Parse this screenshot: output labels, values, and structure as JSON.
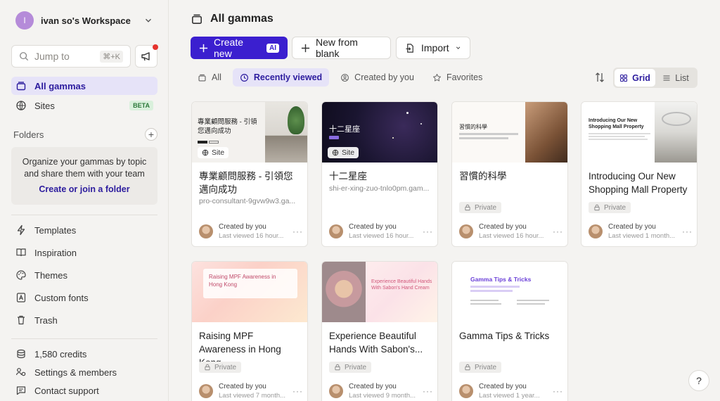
{
  "sidebar": {
    "workspace": {
      "initial": "I",
      "name": "ivan so's Workspace"
    },
    "search": {
      "placeholder": "Jump to",
      "shortcut": "⌘+K"
    },
    "nav": [
      {
        "label": "All gammas"
      },
      {
        "label": "Sites",
        "badge": "BETA"
      }
    ],
    "folders": {
      "title": "Folders",
      "empty_text": "Organize your gammas by topic and share them with your team",
      "cta": "Create or join a folder"
    },
    "links": [
      {
        "label": "Templates"
      },
      {
        "label": "Inspiration"
      },
      {
        "label": "Themes"
      },
      {
        "label": "Custom fonts"
      },
      {
        "label": "Trash"
      }
    ],
    "bottom": [
      {
        "label": "1,580 credits"
      },
      {
        "label": "Settings & members"
      },
      {
        "label": "Contact support"
      }
    ]
  },
  "main": {
    "title": "All gammas",
    "actions": {
      "create_new": "Create new",
      "ai_badge": "AI",
      "new_from_blank": "New from blank",
      "import": "Import"
    },
    "filters": [
      {
        "label": "All"
      },
      {
        "label": "Recently viewed"
      },
      {
        "label": "Created by you"
      },
      {
        "label": "Favorites"
      }
    ],
    "view": {
      "grid": "Grid",
      "list": "List"
    },
    "cards": [
      {
        "title": "專業顧問服務 - 引領您邁向成功",
        "subtitle": "pro-consultant-9gvw9w3.ga...",
        "site_badge": "Site",
        "creator": "Created by you",
        "viewed": "Last viewed 16 hour...",
        "thumb_text": "專業顧問服務 - 引領您邁向成功"
      },
      {
        "title": "十二星座",
        "subtitle": "shi-er-xing-zuo-tnlo0pm.gam...",
        "site_badge": "Site",
        "creator": "Created by you",
        "viewed": "Last viewed 16 hour...",
        "thumb_text": "十二星座"
      },
      {
        "title": "習慣的科學",
        "privacy": "Private",
        "creator": "Created by you",
        "viewed": "Last viewed 16 hour...",
        "thumb_text": "習慣的科學"
      },
      {
        "title": "Introducing Our New Shopping Mall Property",
        "privacy": "Private",
        "creator": "Created by you",
        "viewed": "Last viewed 1 month...",
        "thumb_text": "Introducing Our New Shopping Mall Property"
      },
      {
        "title": "Raising MPF Awareness in Hong Kong",
        "privacy": "Private",
        "creator": "Created by you",
        "viewed": "Last viewed 7 month...",
        "thumb_text": "Raising MPF Awareness in Hong Kong"
      },
      {
        "title": "Experience Beautiful Hands With Sabon's...",
        "privacy": "Private",
        "creator": "Created by you",
        "viewed": "Last viewed 9 month...",
        "thumb_text": "Experience Beautiful Hands With Sabon's Hand Cream"
      },
      {
        "title": "Gamma Tips & Tricks",
        "privacy": "Private",
        "creator": "Created by you",
        "viewed": "Last viewed 1 year...",
        "thumb_text": "Gamma Tips & Tricks"
      }
    ],
    "help": "?"
  },
  "colors": {
    "accent": "#3b1fcf",
    "active_bg": "#e6e3f8",
    "beta_bg": "#d9f0dc"
  }
}
